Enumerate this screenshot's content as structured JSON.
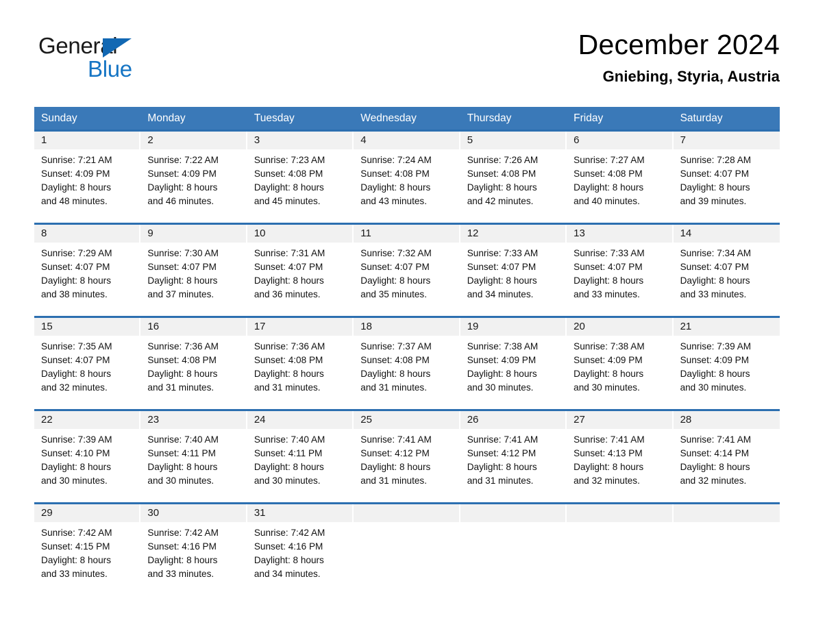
{
  "logo": {
    "word_one": "General",
    "word_two": "Blue",
    "triangle_color": "#1268b3",
    "blue_text_color": "#1675c4"
  },
  "header": {
    "title": "December 2024",
    "location": "Gniebing, Styria, Austria"
  },
  "theme": {
    "header_blue": "#3a79b8",
    "rule_blue": "#2c6fb0",
    "daynum_band": "#f1f1f1"
  },
  "calendar": {
    "weekdays": [
      "Sunday",
      "Monday",
      "Tuesday",
      "Wednesday",
      "Thursday",
      "Friday",
      "Saturday"
    ],
    "weeks": [
      [
        {
          "day": "1",
          "sunrise": "Sunrise: 7:21 AM",
          "sunset": "Sunset: 4:09 PM",
          "daylight_line1": "Daylight: 8 hours",
          "daylight_line2": "and 48 minutes."
        },
        {
          "day": "2",
          "sunrise": "Sunrise: 7:22 AM",
          "sunset": "Sunset: 4:09 PM",
          "daylight_line1": "Daylight: 8 hours",
          "daylight_line2": "and 46 minutes."
        },
        {
          "day": "3",
          "sunrise": "Sunrise: 7:23 AM",
          "sunset": "Sunset: 4:08 PM",
          "daylight_line1": "Daylight: 8 hours",
          "daylight_line2": "and 45 minutes."
        },
        {
          "day": "4",
          "sunrise": "Sunrise: 7:24 AM",
          "sunset": "Sunset: 4:08 PM",
          "daylight_line1": "Daylight: 8 hours",
          "daylight_line2": "and 43 minutes."
        },
        {
          "day": "5",
          "sunrise": "Sunrise: 7:26 AM",
          "sunset": "Sunset: 4:08 PM",
          "daylight_line1": "Daylight: 8 hours",
          "daylight_line2": "and 42 minutes."
        },
        {
          "day": "6",
          "sunrise": "Sunrise: 7:27 AM",
          "sunset": "Sunset: 4:08 PM",
          "daylight_line1": "Daylight: 8 hours",
          "daylight_line2": "and 40 minutes."
        },
        {
          "day": "7",
          "sunrise": "Sunrise: 7:28 AM",
          "sunset": "Sunset: 4:07 PM",
          "daylight_line1": "Daylight: 8 hours",
          "daylight_line2": "and 39 minutes."
        }
      ],
      [
        {
          "day": "8",
          "sunrise": "Sunrise: 7:29 AM",
          "sunset": "Sunset: 4:07 PM",
          "daylight_line1": "Daylight: 8 hours",
          "daylight_line2": "and 38 minutes."
        },
        {
          "day": "9",
          "sunrise": "Sunrise: 7:30 AM",
          "sunset": "Sunset: 4:07 PM",
          "daylight_line1": "Daylight: 8 hours",
          "daylight_line2": "and 37 minutes."
        },
        {
          "day": "10",
          "sunrise": "Sunrise: 7:31 AM",
          "sunset": "Sunset: 4:07 PM",
          "daylight_line1": "Daylight: 8 hours",
          "daylight_line2": "and 36 minutes."
        },
        {
          "day": "11",
          "sunrise": "Sunrise: 7:32 AM",
          "sunset": "Sunset: 4:07 PM",
          "daylight_line1": "Daylight: 8 hours",
          "daylight_line2": "and 35 minutes."
        },
        {
          "day": "12",
          "sunrise": "Sunrise: 7:33 AM",
          "sunset": "Sunset: 4:07 PM",
          "daylight_line1": "Daylight: 8 hours",
          "daylight_line2": "and 34 minutes."
        },
        {
          "day": "13",
          "sunrise": "Sunrise: 7:33 AM",
          "sunset": "Sunset: 4:07 PM",
          "daylight_line1": "Daylight: 8 hours",
          "daylight_line2": "and 33 minutes."
        },
        {
          "day": "14",
          "sunrise": "Sunrise: 7:34 AM",
          "sunset": "Sunset: 4:07 PM",
          "daylight_line1": "Daylight: 8 hours",
          "daylight_line2": "and 33 minutes."
        }
      ],
      [
        {
          "day": "15",
          "sunrise": "Sunrise: 7:35 AM",
          "sunset": "Sunset: 4:07 PM",
          "daylight_line1": "Daylight: 8 hours",
          "daylight_line2": "and 32 minutes."
        },
        {
          "day": "16",
          "sunrise": "Sunrise: 7:36 AM",
          "sunset": "Sunset: 4:08 PM",
          "daylight_line1": "Daylight: 8 hours",
          "daylight_line2": "and 31 minutes."
        },
        {
          "day": "17",
          "sunrise": "Sunrise: 7:36 AM",
          "sunset": "Sunset: 4:08 PM",
          "daylight_line1": "Daylight: 8 hours",
          "daylight_line2": "and 31 minutes."
        },
        {
          "day": "18",
          "sunrise": "Sunrise: 7:37 AM",
          "sunset": "Sunset: 4:08 PM",
          "daylight_line1": "Daylight: 8 hours",
          "daylight_line2": "and 31 minutes."
        },
        {
          "day": "19",
          "sunrise": "Sunrise: 7:38 AM",
          "sunset": "Sunset: 4:09 PM",
          "daylight_line1": "Daylight: 8 hours",
          "daylight_line2": "and 30 minutes."
        },
        {
          "day": "20",
          "sunrise": "Sunrise: 7:38 AM",
          "sunset": "Sunset: 4:09 PM",
          "daylight_line1": "Daylight: 8 hours",
          "daylight_line2": "and 30 minutes."
        },
        {
          "day": "21",
          "sunrise": "Sunrise: 7:39 AM",
          "sunset": "Sunset: 4:09 PM",
          "daylight_line1": "Daylight: 8 hours",
          "daylight_line2": "and 30 minutes."
        }
      ],
      [
        {
          "day": "22",
          "sunrise": "Sunrise: 7:39 AM",
          "sunset": "Sunset: 4:10 PM",
          "daylight_line1": "Daylight: 8 hours",
          "daylight_line2": "and 30 minutes."
        },
        {
          "day": "23",
          "sunrise": "Sunrise: 7:40 AM",
          "sunset": "Sunset: 4:11 PM",
          "daylight_line1": "Daylight: 8 hours",
          "daylight_line2": "and 30 minutes."
        },
        {
          "day": "24",
          "sunrise": "Sunrise: 7:40 AM",
          "sunset": "Sunset: 4:11 PM",
          "daylight_line1": "Daylight: 8 hours",
          "daylight_line2": "and 30 minutes."
        },
        {
          "day": "25",
          "sunrise": "Sunrise: 7:41 AM",
          "sunset": "Sunset: 4:12 PM",
          "daylight_line1": "Daylight: 8 hours",
          "daylight_line2": "and 31 minutes."
        },
        {
          "day": "26",
          "sunrise": "Sunrise: 7:41 AM",
          "sunset": "Sunset: 4:12 PM",
          "daylight_line1": "Daylight: 8 hours",
          "daylight_line2": "and 31 minutes."
        },
        {
          "day": "27",
          "sunrise": "Sunrise: 7:41 AM",
          "sunset": "Sunset: 4:13 PM",
          "daylight_line1": "Daylight: 8 hours",
          "daylight_line2": "and 32 minutes."
        },
        {
          "day": "28",
          "sunrise": "Sunrise: 7:41 AM",
          "sunset": "Sunset: 4:14 PM",
          "daylight_line1": "Daylight: 8 hours",
          "daylight_line2": "and 32 minutes."
        }
      ],
      [
        {
          "day": "29",
          "sunrise": "Sunrise: 7:42 AM",
          "sunset": "Sunset: 4:15 PM",
          "daylight_line1": "Daylight: 8 hours",
          "daylight_line2": "and 33 minutes."
        },
        {
          "day": "30",
          "sunrise": "Sunrise: 7:42 AM",
          "sunset": "Sunset: 4:16 PM",
          "daylight_line1": "Daylight: 8 hours",
          "daylight_line2": "and 33 minutes."
        },
        {
          "day": "31",
          "sunrise": "Sunrise: 7:42 AM",
          "sunset": "Sunset: 4:16 PM",
          "daylight_line1": "Daylight: 8 hours",
          "daylight_line2": "and 34 minutes."
        },
        {
          "day": "",
          "sunrise": "",
          "sunset": "",
          "daylight_line1": "",
          "daylight_line2": ""
        },
        {
          "day": "",
          "sunrise": "",
          "sunset": "",
          "daylight_line1": "",
          "daylight_line2": ""
        },
        {
          "day": "",
          "sunrise": "",
          "sunset": "",
          "daylight_line1": "",
          "daylight_line2": ""
        },
        {
          "day": "",
          "sunrise": "",
          "sunset": "",
          "daylight_line1": "",
          "daylight_line2": ""
        }
      ]
    ]
  }
}
